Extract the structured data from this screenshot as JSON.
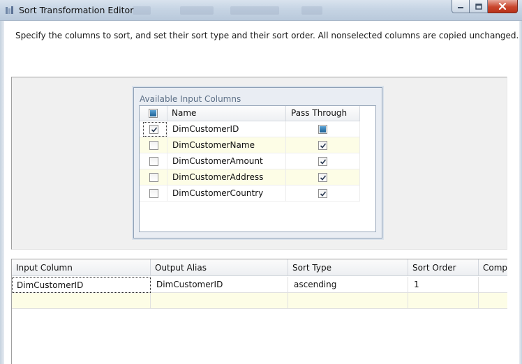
{
  "window": {
    "title": "Sort Transformation Editor"
  },
  "description": "Specify the columns to sort, and set their sort type and their sort order. All nonselected columns are copied unchanged.",
  "available_input_columns": {
    "title": "Available Input Columns",
    "headers": {
      "name": "Name",
      "pass_through": "Pass Through"
    },
    "rows": [
      {
        "name": "DimCustomerID",
        "selected": true,
        "pass_through": "indeterminate"
      },
      {
        "name": "DimCustomerName",
        "selected": false,
        "pass_through": "checked"
      },
      {
        "name": "DimCustomerAmount",
        "selected": false,
        "pass_through": "checked"
      },
      {
        "name": "DimCustomerAddress",
        "selected": false,
        "pass_through": "checked"
      },
      {
        "name": "DimCustomerCountry",
        "selected": false,
        "pass_through": "checked"
      }
    ]
  },
  "sort_grid": {
    "headers": {
      "input_column": "Input Column",
      "output_alias": "Output Alias",
      "sort_type": "Sort Type",
      "sort_order": "Sort Order",
      "comparison": "Compa"
    },
    "rows": [
      {
        "input_column": "DimCustomerID",
        "output_alias": "DimCustomerID",
        "sort_type": "ascending",
        "sort_order": "1",
        "comparison": ""
      }
    ]
  },
  "colors": {
    "titlebar": "#c6d4e4",
    "close_button": "#c9462c",
    "panel_gray": "#f0f0f0",
    "alt_row": "#fdfde6",
    "group_title": "#5c6f86"
  }
}
